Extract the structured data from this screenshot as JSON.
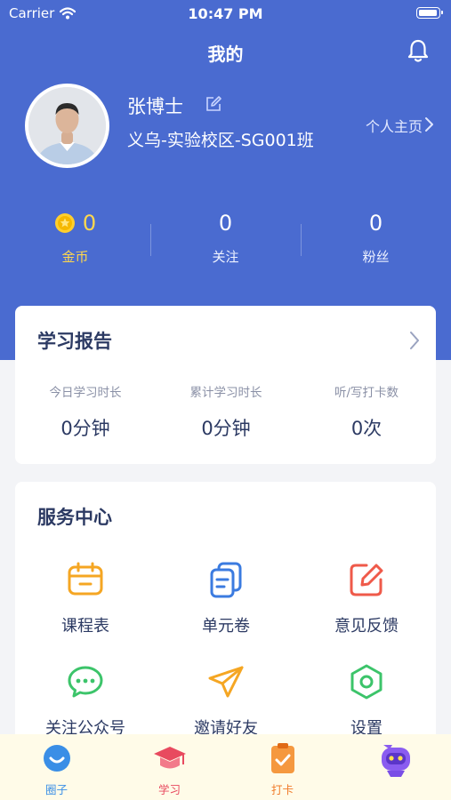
{
  "status_bar": {
    "carrier": "Carrier",
    "time": "10:47 PM"
  },
  "header": {
    "title": "我的"
  },
  "profile": {
    "name": "张博士",
    "class_name": "义乌-实验校区-SG001班",
    "homepage_link": "个人主页"
  },
  "stats": [
    {
      "value": "0",
      "label": "金币"
    },
    {
      "value": "0",
      "label": "关注"
    },
    {
      "value": "0",
      "label": "粉丝"
    }
  ],
  "report": {
    "title": "学习报告",
    "items": [
      {
        "label": "今日学习时长",
        "value": "0分钟"
      },
      {
        "label": "累计学习时长",
        "value": "0分钟"
      },
      {
        "label": "听/写打卡数",
        "value": "0次"
      }
    ]
  },
  "services": {
    "title": "服务中心",
    "items": [
      {
        "label": "课程表",
        "icon": "calendar-icon",
        "color": "#f5a623"
      },
      {
        "label": "单元卷",
        "icon": "documents-icon",
        "color": "#3b7be0"
      },
      {
        "label": "意见反馈",
        "icon": "feedback-edit-icon",
        "color": "#ef5a4a"
      },
      {
        "label": "关注公众号",
        "icon": "wechat-icon",
        "color": "#3cc46a"
      },
      {
        "label": "邀请好友",
        "icon": "paper-plane-icon",
        "color": "#f5a623"
      },
      {
        "label": "设置",
        "icon": "settings-icon",
        "color": "#3cc46a"
      }
    ]
  },
  "tabbar": [
    {
      "label": "圈子",
      "icon": "circle-chat-icon",
      "color": "#3a8ee6"
    },
    {
      "label": "学习",
      "icon": "graduation-cap-icon",
      "color": "#e84a5f"
    },
    {
      "label": "打卡",
      "icon": "clipboard-check-icon",
      "color": "#f07c2a"
    },
    {
      "label": "",
      "icon": "robot-mascot-icon",
      "color": "#8a5cf0"
    }
  ],
  "colors": {
    "primary": "#4a6bd0",
    "gold": "#ffd84d",
    "tabbar_bg": "#fffbe8"
  }
}
